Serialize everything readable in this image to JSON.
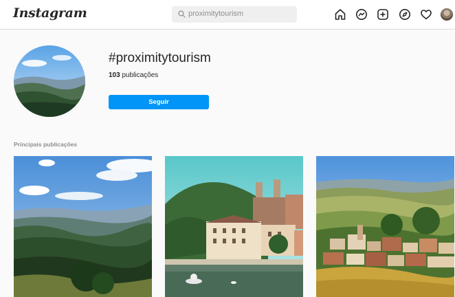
{
  "header": {
    "logo": "Instagram",
    "search_value": "proximitytourism",
    "icons": [
      "home-icon",
      "messenger-icon",
      "new-post-icon",
      "explore-icon",
      "activity-heart-icon",
      "profile-avatar"
    ]
  },
  "hashtag": {
    "name": "#proximitytourism",
    "post_count": "103",
    "post_count_label": "publicações",
    "follow_label": "Seguir"
  },
  "top_posts": {
    "title": "Principais publicações",
    "posts": [
      {
        "subject": "mountain valley landscape"
      },
      {
        "subject": "lake town with castle"
      },
      {
        "subject": "vineyard village"
      }
    ]
  },
  "colors": {
    "accent": "#0095f6",
    "background": "#fafafa",
    "text": "#262626",
    "muted": "#8e8e8e",
    "border": "#dbdbdb"
  }
}
